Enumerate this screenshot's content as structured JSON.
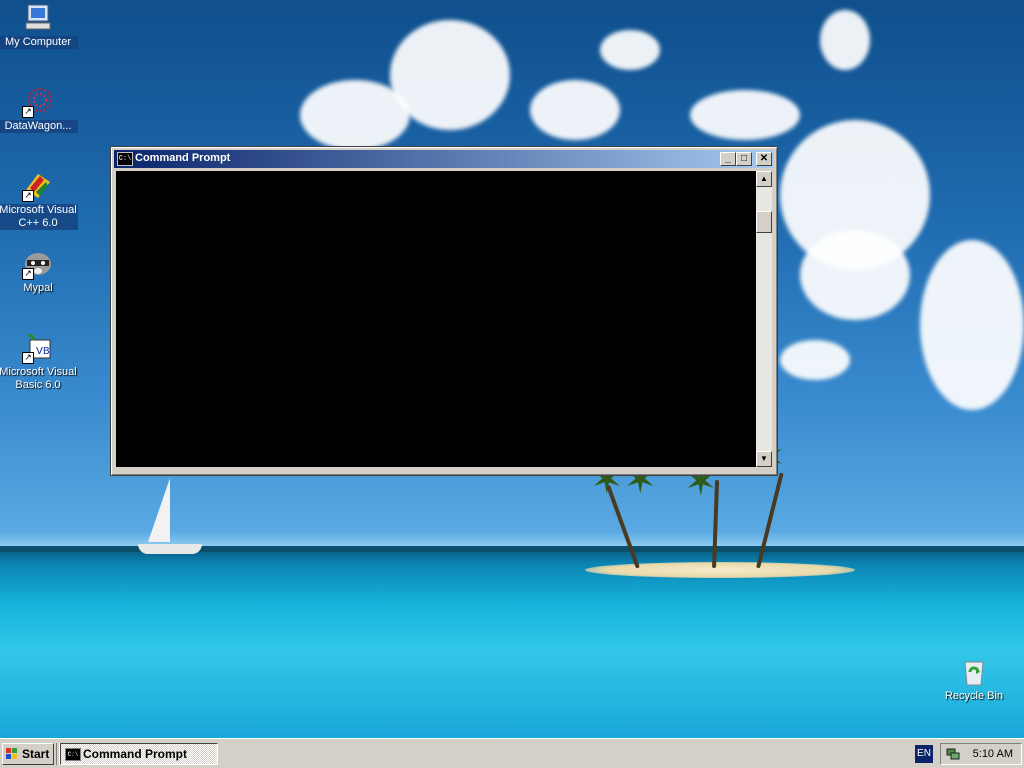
{
  "desktop": {
    "icons": [
      {
        "label": "My Computer",
        "icon": "my-computer-icon"
      },
      {
        "label": "DataWagon...",
        "icon": "datawagon-icon"
      },
      {
        "label": "Microsoft Visual C++ 6.0",
        "icon": "visual-cpp-icon"
      },
      {
        "label": "Mypal",
        "icon": "mypal-raccoon-icon"
      },
      {
        "label": "Microsoft Visual Basic 6.0",
        "icon": "visual-basic-icon"
      },
      {
        "label": "Recycle Bin",
        "icon": "recycle-bin-icon"
      }
    ]
  },
  "window": {
    "title": "Command Prompt",
    "app_icon_text": "C:\\",
    "minimize_glyph": "_",
    "maximize_glyph": "□",
    "close_glyph": "✕",
    "console_text": ""
  },
  "taskbar": {
    "start_label": "Start",
    "tasks": [
      {
        "label": "Command Prompt",
        "icon": "cmd-icon"
      }
    ],
    "language": "EN",
    "clock": "5:10 AM"
  },
  "colors": {
    "titlebar_start": "#0a246a",
    "titlebar_end": "#a6caf0",
    "chrome": "#d4d0c8",
    "console_bg": "#000000"
  }
}
